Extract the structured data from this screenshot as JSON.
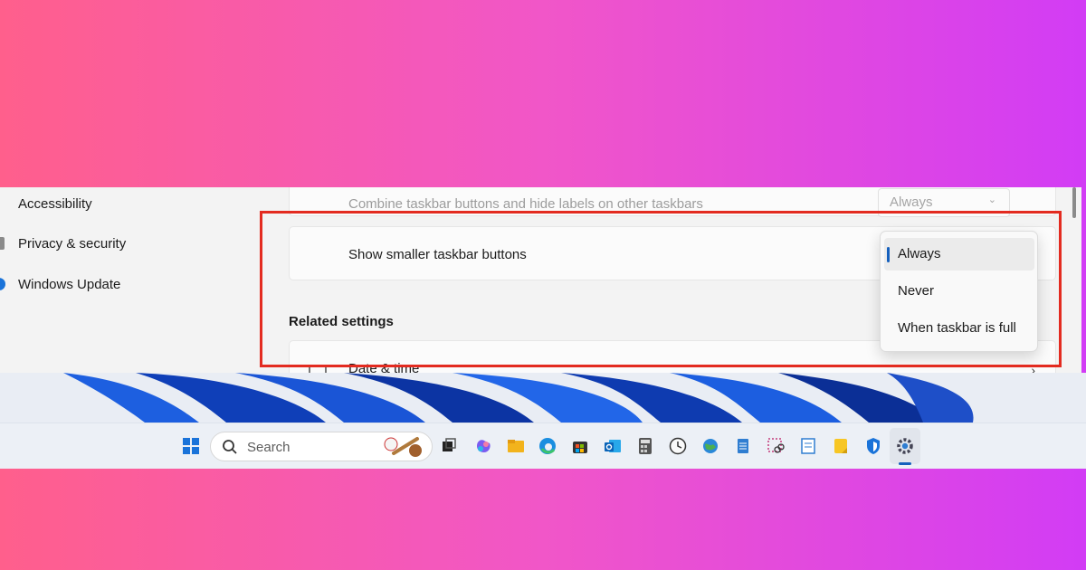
{
  "settings": {
    "nav": [
      {
        "label": "Accessibility"
      },
      {
        "label": "Privacy & security"
      },
      {
        "label": "Windows Update"
      }
    ],
    "combine_other_label": "Combine taskbar buttons and hide labels on other taskbars",
    "combine_other_value": "Always",
    "smaller_buttons_label": "Show smaller taskbar buttons",
    "related_settings_title": "Related settings",
    "date_time_label": "Date & time"
  },
  "dropdown": {
    "options": [
      "Always",
      "Never",
      "When taskbar is full"
    ],
    "selected": "Always"
  },
  "taskbar": {
    "search_placeholder": "Search",
    "icons": [
      "start-icon",
      "search-icon",
      "task-view-icon",
      "copilot-icon",
      "file-explorer-icon",
      "edge-icon",
      "store-icon",
      "outlook-icon",
      "calculator-icon",
      "clock-icon",
      "weather-icon",
      "notepad-icon",
      "snipping-tool-icon",
      "wordpad-icon",
      "sticky-notes-icon",
      "defender-icon",
      "settings-icon"
    ],
    "active_app": "settings-icon"
  },
  "colors": {
    "accent": "#1560bd",
    "highlight_box": "#e32b20"
  }
}
